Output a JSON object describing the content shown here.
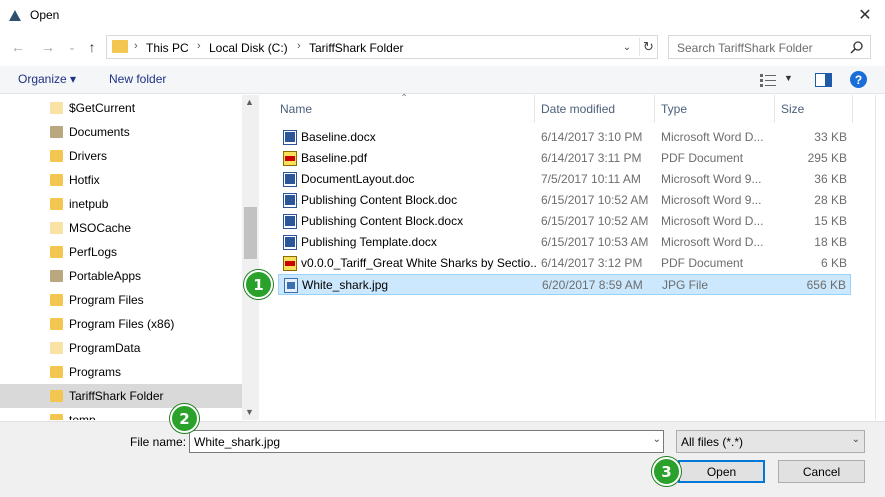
{
  "window": {
    "title": "Open"
  },
  "address": {
    "crumbs": [
      "This PC",
      "Local Disk (C:)",
      "TariffShark Folder"
    ]
  },
  "search": {
    "placeholder": "Search TariffShark Folder"
  },
  "toolbar": {
    "organize_label": "Organize ▾",
    "new_folder_label": "New folder"
  },
  "tree": {
    "items": [
      {
        "label": "$GetCurrent",
        "icon": "folder-icon"
      },
      {
        "label": "Documents",
        "icon": "documents-folder-icon"
      },
      {
        "label": "Drivers",
        "icon": "folder-icon"
      },
      {
        "label": "Hotfix",
        "icon": "folder-icon"
      },
      {
        "label": "inetpub",
        "icon": "folder-icon"
      },
      {
        "label": "MSOCache",
        "icon": "folder-icon"
      },
      {
        "label": "PerfLogs",
        "icon": "folder-icon"
      },
      {
        "label": "PortableApps",
        "icon": "special-folder-icon"
      },
      {
        "label": "Program Files",
        "icon": "folder-icon"
      },
      {
        "label": "Program Files (x86)",
        "icon": "folder-icon"
      },
      {
        "label": "ProgramData",
        "icon": "folder-icon"
      },
      {
        "label": "Programs",
        "icon": "folder-icon"
      },
      {
        "label": "TariffShark Folder",
        "icon": "folder-icon"
      },
      {
        "label": "temp",
        "icon": "folder-icon"
      }
    ],
    "selected": "TariffShark Folder"
  },
  "columns": {
    "name": "Name",
    "date": "Date modified",
    "type": "Type",
    "size": "Size"
  },
  "files": [
    {
      "name": "Baseline.docx",
      "date": "6/14/2017 3:10 PM",
      "type": "Microsoft Word D...",
      "size": "33 KB",
      "icon": "word-doc-icon"
    },
    {
      "name": "Baseline.pdf",
      "date": "6/14/2017 3:11 PM",
      "type": "PDF Document",
      "size": "295 KB",
      "icon": "pdf-icon"
    },
    {
      "name": "DocumentLayout.doc",
      "date": "7/5/2017 10:11 AM",
      "type": "Microsoft Word 9...",
      "size": "36 KB",
      "icon": "word-doc-icon"
    },
    {
      "name": "Publishing Content Block.doc",
      "date": "6/15/2017 10:52 AM",
      "type": "Microsoft Word 9...",
      "size": "28 KB",
      "icon": "word-doc-icon"
    },
    {
      "name": "Publishing Content Block.docx",
      "date": "6/15/2017 10:52 AM",
      "type": "Microsoft Word D...",
      "size": "15 KB",
      "icon": "word-doc-icon"
    },
    {
      "name": "Publishing Template.docx",
      "date": "6/15/2017 10:53 AM",
      "type": "Microsoft Word D...",
      "size": "18 KB",
      "icon": "word-doc-icon"
    },
    {
      "name": "v0.0.0_Tariff_Great White Sharks by Sectio...",
      "date": "6/14/2017 3:12 PM",
      "type": "PDF Document",
      "size": "6 KB",
      "icon": "pdf-icon"
    },
    {
      "name": "White_shark.jpg",
      "date": "6/20/2017 8:59 AM",
      "type": "JPG File",
      "size": "656 KB",
      "icon": "jpg-icon"
    }
  ],
  "selected_file": "White_shark.jpg",
  "bottom": {
    "filename_label": "File name:",
    "filename_value": "White_shark.jpg",
    "filter_value": "All files (*.*)",
    "open_label": "Open",
    "cancel_label": "Cancel"
  },
  "badges": [
    "1",
    "2",
    "3"
  ],
  "colors": {
    "badge": "#2aa12a",
    "selection": "#cce8ff",
    "accent": "#0078d7"
  }
}
